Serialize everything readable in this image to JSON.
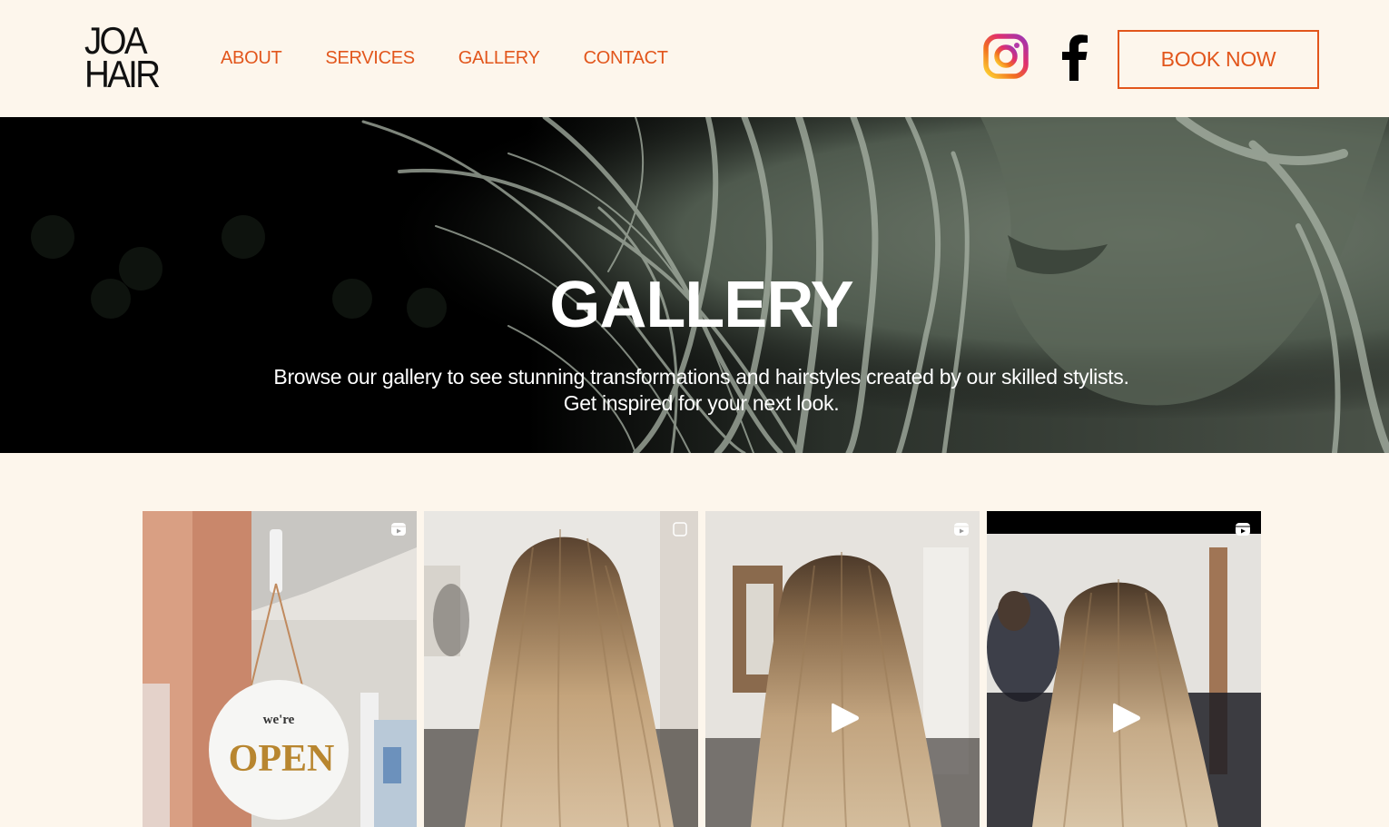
{
  "brand": {
    "logo_line1": "JOA",
    "logo_line2": "HAIR",
    "accent_color": "#e2561c",
    "background_color": "#fdf6ec"
  },
  "nav": {
    "items": [
      {
        "label": "ABOUT"
      },
      {
        "label": "SERVICES"
      },
      {
        "label": "GALLERY"
      },
      {
        "label": "CONTACT"
      }
    ]
  },
  "social": {
    "instagram_icon": "instagram-icon",
    "facebook_icon": "facebook-icon"
  },
  "header": {
    "book_button_label": "BOOK NOW"
  },
  "hero": {
    "title": "GALLERY",
    "subtitle": "Browse our gallery to see stunning transformations and hairstyles created by our skilled stylists. Get inspired for your next look."
  },
  "gallery": {
    "tiles": [
      {
        "type": "reel",
        "alt": "We're open sign",
        "sign_small": "we're",
        "sign_big": "OPEN",
        "badge": "reel-icon",
        "has_play": false
      },
      {
        "type": "carousel",
        "alt": "Long blonde balayage hair from behind",
        "badge": "carousel-icon",
        "has_play": false
      },
      {
        "type": "reel",
        "alt": "Blonde wavy hair video",
        "badge": "reel-icon",
        "has_play": true
      },
      {
        "type": "reel",
        "alt": "Blonde balayage hair video",
        "badge": "reel-icon",
        "has_play": true
      }
    ]
  }
}
